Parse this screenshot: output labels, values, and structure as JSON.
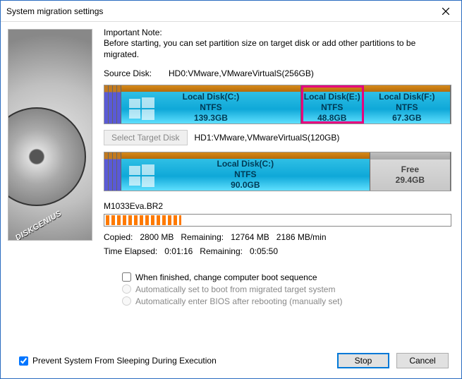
{
  "window": {
    "title": "System migration settings"
  },
  "sidebar": {
    "brand": "DISKGENIUS"
  },
  "note": {
    "title": "Important Note:",
    "body": "Before starting, you can set partition size on target disk or add other partitions to be migrated."
  },
  "source": {
    "label": "Source Disk:",
    "value": "HD0:VMware,VMwareVirtualS(256GB)",
    "partitions": [
      {
        "name": "Local Disk(C:)",
        "fs": "NTFS",
        "size": "139.3GB",
        "flex": 139,
        "winlogo": true,
        "selected": false
      },
      {
        "name": "Local Disk(E:)",
        "fs": "NTFS",
        "size": "48.8GB",
        "flex": 48,
        "selected": true
      },
      {
        "name": "Local Disk(F:)",
        "fs": "NTFS",
        "size": "67.3GB",
        "flex": 67,
        "selected": false
      }
    ]
  },
  "target": {
    "button_label": "Select Target Disk",
    "value": "HD1:VMware,VMwareVirtualS(120GB)",
    "partitions": [
      {
        "name": "Local Disk(C:)",
        "fs": "NTFS",
        "size": "90.0GB",
        "flex": 90,
        "winlogo": true,
        "free": false
      },
      {
        "name": "Free",
        "fs": "",
        "size": "29.4GB",
        "flex": 29,
        "free": true
      }
    ]
  },
  "progress": {
    "current_file": "M1033Eva.BR2",
    "line1": "Copied:   2800 MB   Remaining:   12764 MB   2186 MB/min",
    "line2": "Time Elapsed:   0:01:16   Remaining:   0:05:50"
  },
  "opts": {
    "chk1": "When finished, change computer boot sequence",
    "rad1": "Automatically set to boot from migrated target system",
    "rad2": "Automatically enter BIOS after rebooting (manually set)"
  },
  "footer": {
    "prevent_sleep": "Prevent System From Sleeping During Execution",
    "stop": "Stop",
    "cancel": "Cancel"
  }
}
